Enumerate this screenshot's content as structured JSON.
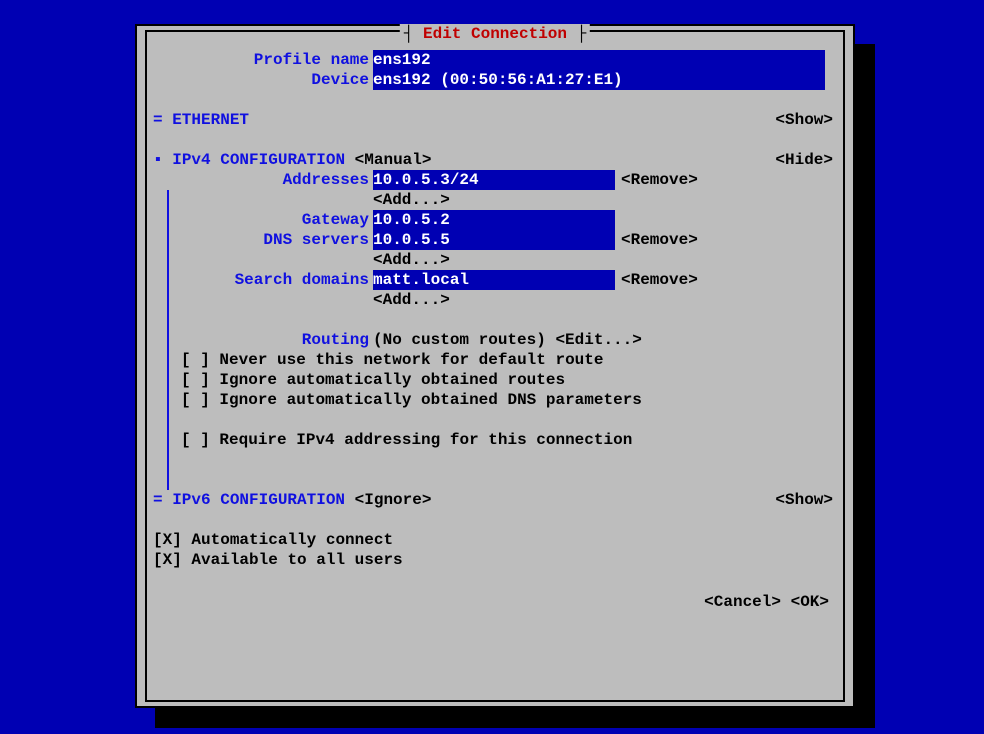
{
  "title": "Edit Connection",
  "labels": {
    "profile_name": "Profile name",
    "device": "Device",
    "ethernet": "= ETHERNET",
    "ipv4_config": "IPv4 CONFIGURATION",
    "addresses": "Addresses",
    "gateway": "Gateway",
    "dns_servers": "DNS servers",
    "search_domains": "Search domains",
    "routing": "Routing",
    "ipv6_config": "= IPv6 CONFIGURATION"
  },
  "values": {
    "profile_name": "ens192",
    "device": "ens192 (00:50:56:A1:27:E1)",
    "ipv4_mode": "<Manual>",
    "address0": "10.0.5.3/24",
    "gateway": "10.0.5.2",
    "dns0": "10.0.5.5",
    "search0": "matt.local",
    "routing_info": "(No custom routes)",
    "ipv6_mode": "<Ignore>"
  },
  "buttons": {
    "show": "<Show>",
    "hide": "<Hide>",
    "remove": "<Remove>",
    "add": "<Add...>",
    "edit": "<Edit...>",
    "cancel": "<Cancel>",
    "ok": "<OK>"
  },
  "checkboxes": {
    "never_default": {
      "mark": "[ ]",
      "label": "Never use this network for default route"
    },
    "ignore_routes": {
      "mark": "[ ]",
      "label": "Ignore automatically obtained routes"
    },
    "ignore_dns": {
      "mark": "[ ]",
      "label": "Ignore automatically obtained DNS parameters"
    },
    "require_ipv4": {
      "mark": "[ ]",
      "label": "Require IPv4 addressing for this connection"
    },
    "auto_connect": {
      "mark": "[X]",
      "label": "Automatically connect"
    },
    "avail_all": {
      "mark": "[X]",
      "label": "Available to all users"
    }
  },
  "markers": {
    "ipv4_bullet": "▪"
  }
}
